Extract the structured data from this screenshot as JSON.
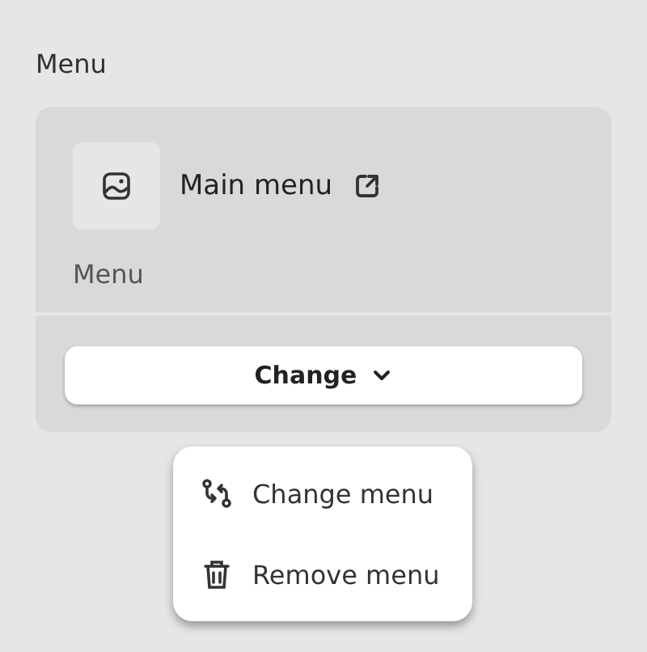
{
  "section_title": "Menu",
  "card": {
    "item_name": "Main menu",
    "item_type": "Menu",
    "button_label": "Change"
  },
  "dropdown": {
    "open": true,
    "items": [
      {
        "label": "Change menu",
        "kind": "swap"
      },
      {
        "label": "Remove menu",
        "kind": "delete"
      }
    ]
  }
}
